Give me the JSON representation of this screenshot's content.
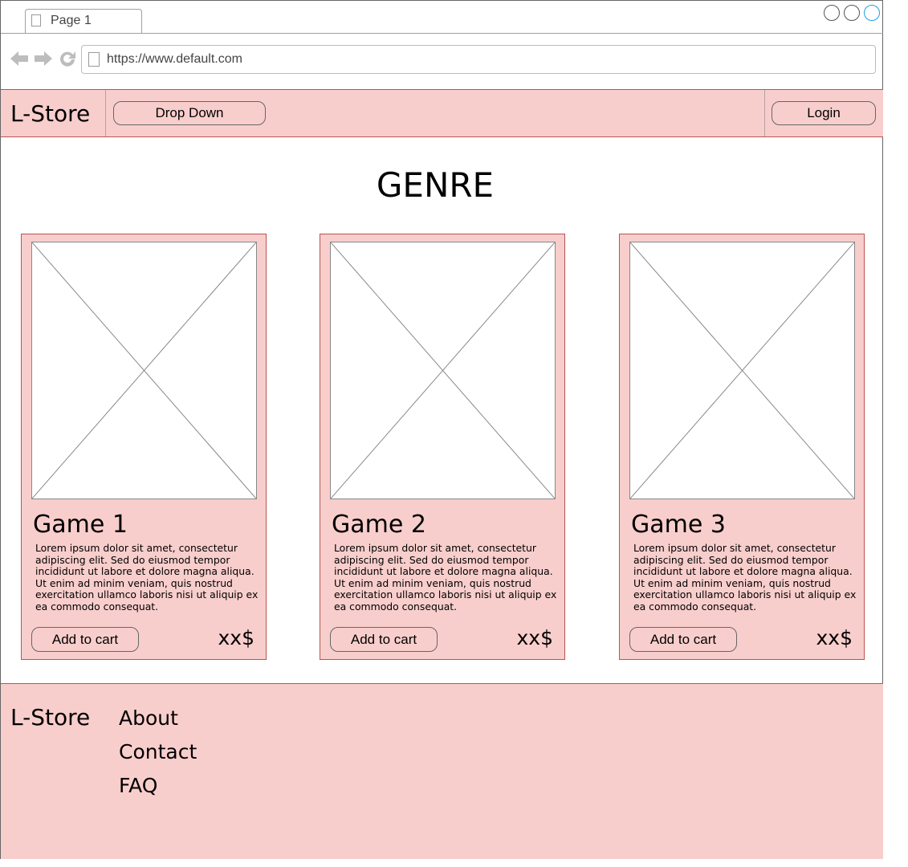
{
  "browser": {
    "tab_label": "Page 1",
    "url": "https://www.default.com",
    "nav_icons": [
      "back-arrow-icon",
      "forward-arrow-icon",
      "reload-icon"
    ],
    "window_controls": [
      "minimize",
      "maximize",
      "close"
    ]
  },
  "header": {
    "brand": "L-Store",
    "dropdown_label": "Drop Down",
    "login_label": "Login",
    "background": "#f8cecc",
    "border_color": "#b85450"
  },
  "main": {
    "heading": "GENRE",
    "cards": [
      {
        "title": "Game 1",
        "description": "Lorem ipsum dolor sit amet, consectetur adipiscing elit. Sed do eiusmod tempor incididunt ut labore et dolore magna aliqua. Ut enim ad minim veniam, quis nostrud exercitation ullamco laboris nisi ut aliquip ex ea commodo consequat.",
        "button_label": "Add to cart",
        "price": "xx$",
        "image": "image-placeholder-icon"
      },
      {
        "title": "Game 2",
        "description": "Lorem ipsum dolor sit amet, consectetur adipiscing elit. Sed do eiusmod tempor incididunt ut labore et dolore magna aliqua. Ut enim ad minim veniam, quis nostrud exercitation ullamco laboris nisi ut aliquip ex ea commodo consequat.",
        "button_label": "Add to cart",
        "price": "xx$",
        "image": "image-placeholder-icon"
      },
      {
        "title": "Game 3",
        "description": "Lorem ipsum dolor sit amet, consectetur adipiscing elit. Sed do eiusmod tempor incididunt ut labore et dolore magna aliqua. Ut enim ad minim veniam, quis nostrud exercitation ullamco laboris nisi ut aliquip ex ea commodo consequat.",
        "button_label": "Add to cart",
        "price": "xx$",
        "image": "image-placeholder-icon"
      }
    ]
  },
  "footer": {
    "brand": "L-Store",
    "links": [
      "About",
      "Contact",
      "FAQ"
    ]
  }
}
